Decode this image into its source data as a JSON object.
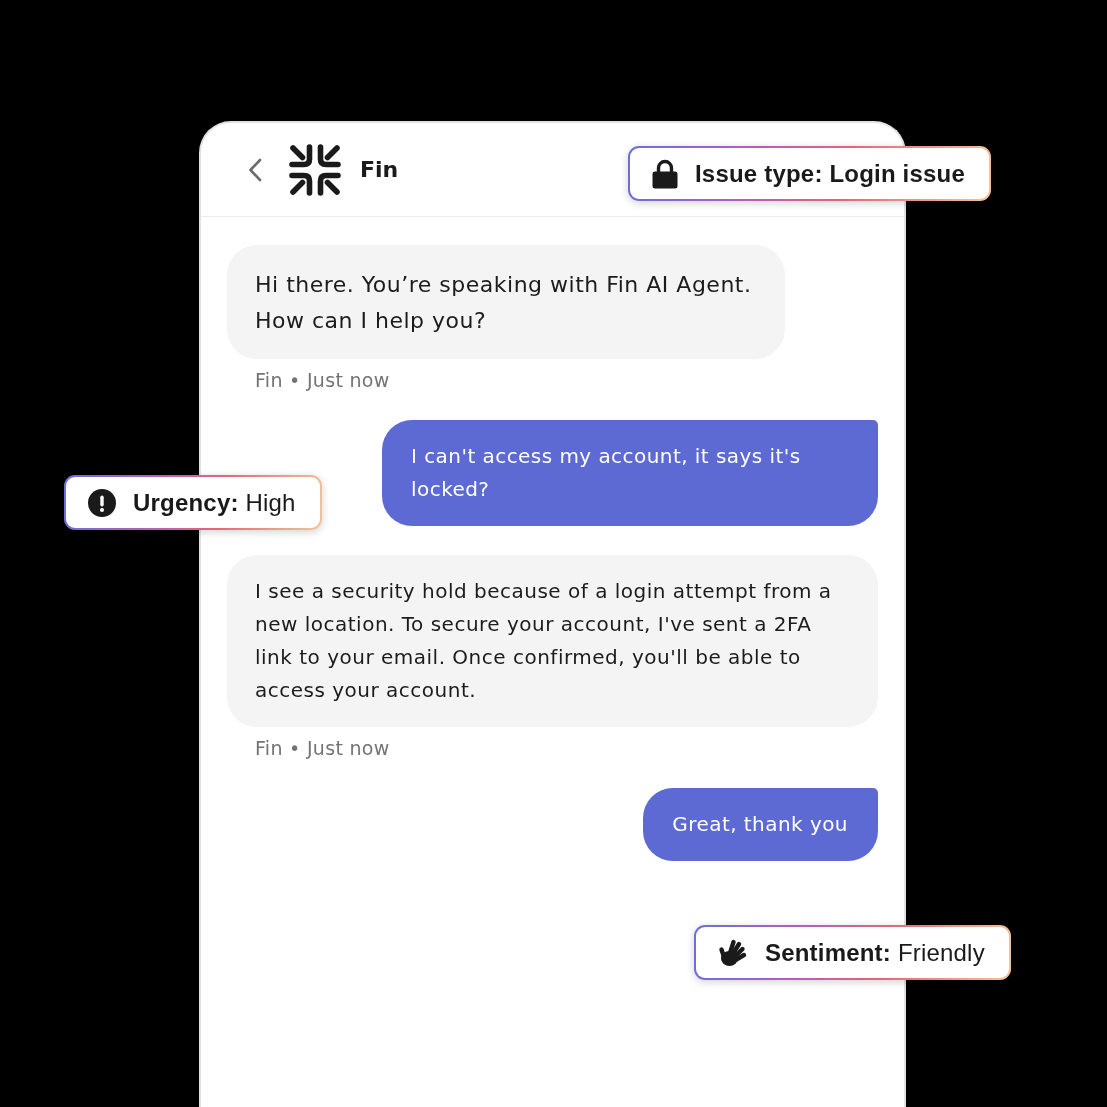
{
  "header": {
    "title": "Fin"
  },
  "messages": [
    {
      "kind": "greeting",
      "text": "Hi there. You’re speaking with Fin AI Agent.\nHow can I help you?",
      "meta": "Fin • Just now"
    },
    {
      "kind": "user",
      "text": "I can't access my account, it says it's locked?"
    },
    {
      "kind": "answer",
      "text": "I see a security hold because of a login attempt from a new location. To secure your account, I've sent a 2FA link to your email. Once confirmed, you'll be able to access your account.",
      "meta": "Fin • Just now"
    },
    {
      "kind": "user",
      "text": "Great, thank you"
    }
  ],
  "tags": [
    {
      "kind": "lock",
      "text": "Issue type: Login issue",
      "bold": true
    },
    {
      "kind": "alert",
      "text": "**Urgency:** High",
      "bold": false
    },
    {
      "kind": "hand",
      "text": "**Sentiment:** Friendly",
      "bold": false
    }
  ]
}
